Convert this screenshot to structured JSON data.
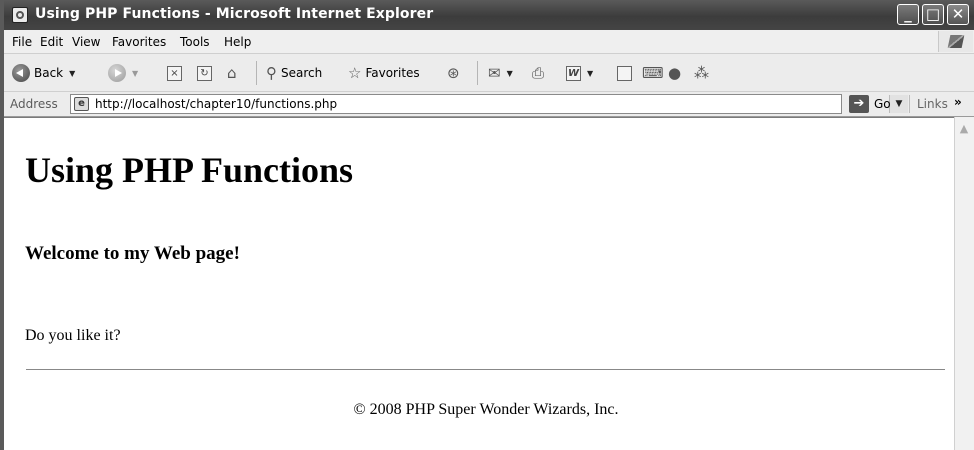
{
  "window": {
    "title": "Using PHP Functions - Microsoft Internet Explorer"
  },
  "menu": [
    "File",
    "Edit",
    "View",
    "Favorites",
    "Tools",
    "Help"
  ],
  "toolbar": {
    "back_label": "Back",
    "search_label": "Search",
    "favorites_label": "Favorites"
  },
  "address": {
    "label": "Address",
    "url": "http://localhost/chapter10/functions.php",
    "go_label": "Go",
    "links_label": "Links"
  },
  "page": {
    "title": "Using PHP Functions",
    "subtitle": "Welcome to my Web page!",
    "question": "Do you like it?",
    "footer": "© 2008 PHP Super Wonder Wizards, Inc."
  }
}
